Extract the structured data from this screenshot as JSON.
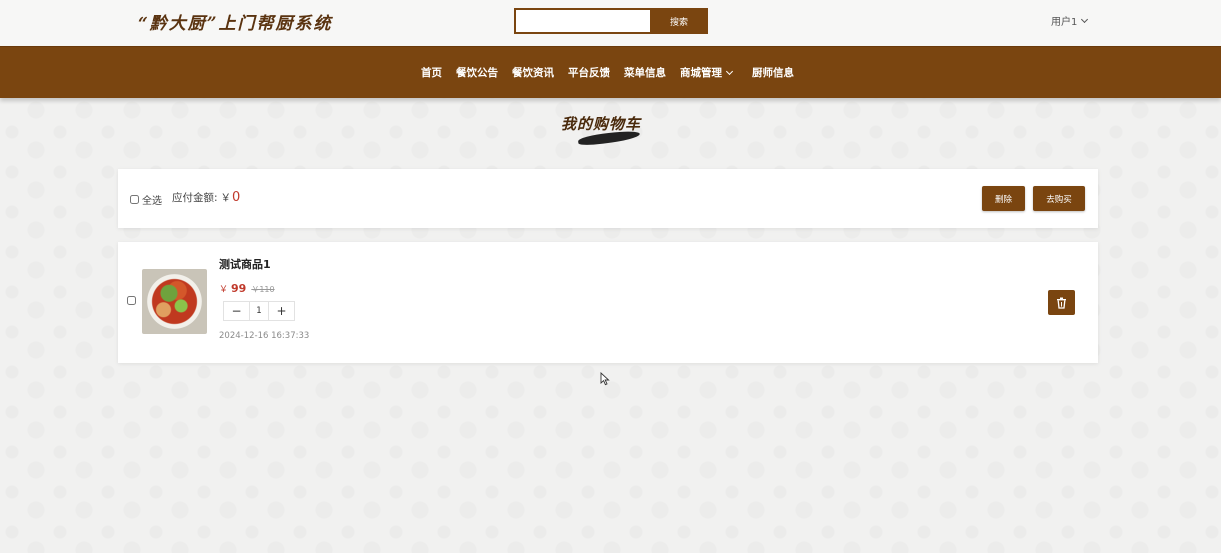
{
  "header": {
    "logo_text": "“黔大厨”上门帮厨系统",
    "search": {
      "placeholder": "",
      "value": "",
      "button_label": "搜索"
    },
    "user_menu_label": "用户1"
  },
  "nav": {
    "items": [
      {
        "label": "首页"
      },
      {
        "label": "餐饮公告"
      },
      {
        "label": "餐饮资讯"
      },
      {
        "label": "平台反馈"
      },
      {
        "label": "菜单信息"
      },
      {
        "label": "商城管理",
        "has_dropdown": true
      },
      {
        "label": "厨师信息"
      }
    ]
  },
  "page": {
    "title": "我的购物车"
  },
  "cart": {
    "select_all_label": "全选",
    "payable_label": "应付金额:",
    "currency_symbol": "￥",
    "payable_amount": "0",
    "delete_label": "删除",
    "checkout_label": "去购买",
    "items": [
      {
        "name": "测试商品1",
        "price_prefix": "￥",
        "price": "99",
        "original_price": "￥110",
        "quantity": "1",
        "minus_label": "−",
        "plus_label": "+",
        "time": "2024-12-16 16:37:33",
        "checked": false
      }
    ]
  },
  "colors": {
    "brand_brown": "#7a4510",
    "price_red": "#c0392b",
    "page_bg": "#f1f1f0"
  },
  "icons": {
    "user_dropdown": "chevron-down-icon",
    "item_delete": "trash-icon",
    "dish_image": "food-image"
  }
}
